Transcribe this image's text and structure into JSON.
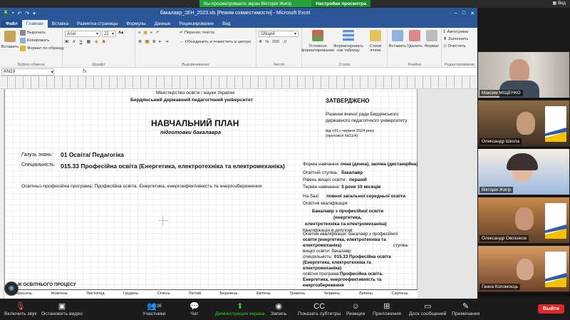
{
  "zoom_top": {
    "share_text": "Вы просматриваете экран Вікторія Жигір",
    "share_option": "Настройки просмотра",
    "view_label": "Вид"
  },
  "excel": {
    "title": "бакалавр_1ЕН_2023.xls  [Режим совместимости]  -  Microsoft Excel",
    "tabs": [
      "Файл",
      "Главная",
      "Вставка",
      "Разметка страницы",
      "Формулы",
      "Данные",
      "Рецензирование",
      "Вид"
    ],
    "clipboard": {
      "paste": "Вставить",
      "cut": "Вырезать",
      "copy": "Копировать",
      "format_painter": "Формат по образцу",
      "label": "Буфер обмена"
    },
    "font": {
      "name": "Arial",
      "size": "22",
      "label": "Шрифт"
    },
    "alignment": {
      "wrap": "Перенос текста",
      "merge": "Объединить и поместить в центре",
      "label": "Выравнивание"
    },
    "number": {
      "format": "Общий",
      "label": "Число"
    },
    "styles": {
      "conditional": "Условное форматирование",
      "as_table": "Форматировать как таблицу",
      "cell_styles": "Стили ячеек",
      "label": "Стили"
    },
    "cells": {
      "insert": "Вставить",
      "delete": "Удалить",
      "format": "Формат",
      "label": "Ячейки"
    },
    "editing": {
      "autosum": "Автосумма",
      "fill": "Заполнить",
      "clear": "Очистить",
      "sort": "Сортировка и фильтр",
      "find": "Найти и выделить",
      "label": "Редактирование"
    },
    "namebox": "AN10",
    "fx": "fx"
  },
  "sheet": {
    "ministry": "Міністерство освіти і науки України",
    "university": "Бердянський державний педагогічний університет",
    "approved": "ЗАТВЕРДЖЕНО",
    "title": "НАВЧАЛЬНИЙ ПЛАН",
    "subtitle": "підготовки бакалавра",
    "decision_1": "Рішення вченої ради Бердянського",
    "decision_2": "державного педагогічного університету",
    "decision_date": "від «01» червня 2024 року",
    "protocol": "(протокол №11/4)",
    "field_label": "Галузь знань:",
    "field_value": "01 Освіта/ Педагогіка",
    "spec_label": "Спеціальність:",
    "spec_value": "015.33 Професійна освіта (Енергетика, електротехніка та електромеханіка)",
    "program": "Освітньо-професійна програма: Професійна освіта. Енергетика, енергоефективність та енергозбереження",
    "form_label": "Форма навчання:",
    "form_value": "очна (денна), заочна (дистанційна)",
    "degree_label": "Освітній ступінь:",
    "degree_value": "бакалавр",
    "level_label": "Рівень вищої освіти:",
    "level_value": "перший",
    "term_label": "Термін навчання:",
    "term_value": "3 роки 10 місяців",
    "base_label": "На базі:",
    "base_value": "повної загальної середньої освіти",
    "qual_label": "Освітня кваліфікація:",
    "qual_value_1": "Бакалавр з професійної освіти",
    "qual_value_2": "(енергетика,",
    "qual_value_3": "електротехніка та електромеханіка)",
    "diploma_label": "Кваліфікація в дипломі:",
    "overlap_1": "Освітня кваліфікація: бакалавр з професійної",
    "overlap_2": "освіти (енергетика, електротехніка та",
    "overlap_3": "електромеханіка)",
    "overlap_step": "ступінь",
    "overlap_4": "вищої освіти: бакалавр",
    "overlap_5_label": "спеціальність:",
    "overlap_5": "015.33 Професійна освіта",
    "overlap_6": "(Енергетика, електротехніка та",
    "overlap_7": "електромеханіка)",
    "overlap_8_label": "освітня програма:",
    "overlap_8": "Професійна освіта.",
    "overlap_9": "Енергетика, енергоефективність та",
    "overlap_10": "енергозбереження",
    "schedule_title": "ІК ОСВІТНЬОГО ПРОЦЕСУ",
    "months": [
      "Вересень",
      "Жовтень",
      "Листопад",
      "Грудень",
      "Січень",
      "Лютий",
      "Березень",
      "Квітень",
      "Травень",
      "Червень",
      "Липень",
      "Серпень"
    ]
  },
  "participants": [
    {
      "name": "Максим МІЩЕНКО"
    },
    {
      "name": "Олександр Школа"
    },
    {
      "name": "Вікторія Жигір"
    },
    {
      "name": "Олександр Овсієнков"
    },
    {
      "name": "Ганна Коломоєць"
    }
  ],
  "zoom_bar": {
    "mute": "Включить звук",
    "video": "Остановить видео",
    "participants": "Участники",
    "participants_count": "26",
    "chat": "Чат",
    "share": "Демонстрация экрана",
    "record": "Запись",
    "captions": "Показать субтитры",
    "reactions": "Реакции",
    "apps": "Приложения",
    "whiteboard": "Доск сообщений",
    "notes": "Примечания",
    "leave": "Выйти"
  },
  "colors": {
    "excel_blue": "#2b579a",
    "share_green": "#25a33a",
    "leave_red": "#e02828"
  }
}
